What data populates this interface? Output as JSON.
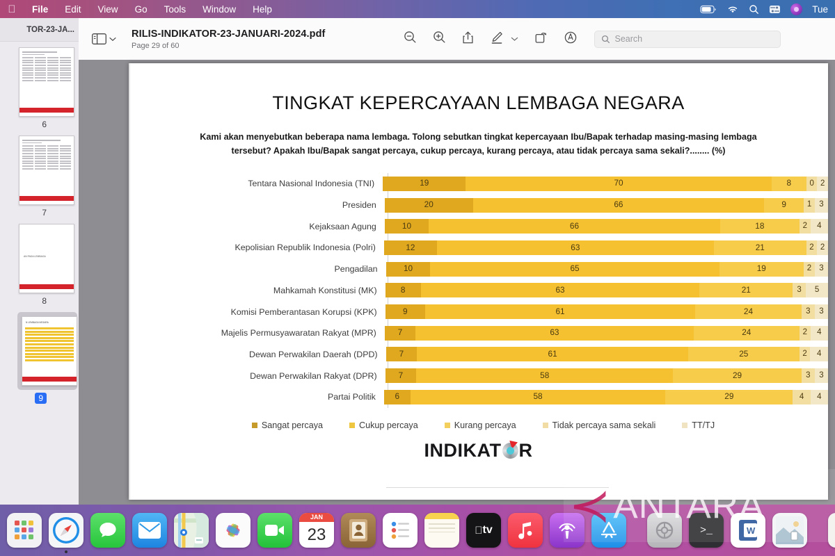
{
  "menubar": {
    "apple_icon": "apple-logo-icon",
    "items": [
      "File",
      "Edit",
      "View",
      "Go",
      "Tools",
      "Window",
      "Help"
    ],
    "status_icons": [
      "battery-icon",
      "wifi-icon",
      "search-icon",
      "control-center-icon",
      "siri-icon"
    ],
    "clock": "Tue"
  },
  "toolbar": {
    "sidebar_toggle_icon": "sidebar-toggle-icon",
    "chevron_icon": "chevron-down-icon",
    "document_title": "RILIS-INDIKATOR-23-JANUARI-2024.pdf",
    "page_status": "Page 29 of 60",
    "icons": [
      "zoom-out-icon",
      "zoom-in-icon",
      "share-icon",
      "markup-icon",
      "markup-chevron-icon",
      "rotate-icon",
      "annotate-icon"
    ],
    "search_placeholder": "Search"
  },
  "sidebar": {
    "header_title": "TOR-23-JA...",
    "thumbnails": [
      {
        "page": "6",
        "kind": "table",
        "selected": false
      },
      {
        "page": "7",
        "kind": "table",
        "selected": false
      },
      {
        "page": "8",
        "kind": "section",
        "caption": "AN PADA LEMBAGA",
        "selected": false
      },
      {
        "page": "9",
        "kind": "chart",
        "caption": "N LEMBAGA NEGARA",
        "selected": true
      }
    ]
  },
  "chart_data": {
    "type": "bar",
    "orientation": "horizontal",
    "stacked": true,
    "title": "TINGKAT KEPERCAYAAN LEMBAGA NEGARA",
    "subtitle": "Kami akan menyebutkan beberapa nama lembaga. Tolong sebutkan tingkat kepercayaan Ibu/Bapak terhadap masing-masing lembaga tersebut? Apakah Ibu/Bapak sangat percaya, cukup percaya, kurang percaya, atau tidak percaya sama sekali?........ (%)",
    "xlabel": "",
    "ylabel": "",
    "xlim": [
      0,
      100
    ],
    "grid": false,
    "legend_position": "bottom",
    "legend": [
      "Sangat percaya",
      "Cukup percaya",
      "Kurang percaya",
      "Tidak percaya sama sekali",
      "TT/TJ"
    ],
    "colors": [
      "#e0a81f",
      "#f5c130",
      "#f7cc4b",
      "#f3dea1",
      "#f2e7c7"
    ],
    "categories": [
      "Tentara Nasional Indonesia (TNI)",
      "Presiden",
      "Kejaksaan Agung",
      "Kepolisian Republik Indonesia (Polri)",
      "Pengadilan",
      "Mahkamah Konstitusi (MK)",
      "Komisi Pemberantasan Korupsi (KPK)",
      "Majelis Permusyawaratan Rakyat (MPR)",
      "Dewan Perwakilan Daerah (DPD)",
      "Dewan Perwakilan Rakyat (DPR)",
      "Partai Politik"
    ],
    "series": [
      {
        "name": "Sangat percaya",
        "values": [
          19,
          20,
          10,
          12,
          10,
          8,
          9,
          7,
          7,
          7,
          6
        ]
      },
      {
        "name": "Cukup percaya",
        "values": [
          70,
          66,
          66,
          63,
          65,
          63,
          61,
          63,
          61,
          58,
          58
        ]
      },
      {
        "name": "Kurang percaya",
        "values": [
          8,
          9,
          18,
          21,
          19,
          21,
          24,
          24,
          25,
          29,
          29
        ]
      },
      {
        "name": "Tidak percaya sama sekali",
        "values": [
          0,
          1,
          2,
          2,
          2,
          3,
          3,
          2,
          2,
          3,
          4
        ]
      },
      {
        "name": "TT/TJ",
        "values": [
          2,
          3,
          4,
          2,
          3,
          5,
          3,
          4,
          4,
          3,
          4
        ]
      }
    ],
    "brand": "INDIKAT",
    "brand_tail": "R"
  },
  "dock": {
    "items": [
      "launchpad-icon",
      "safari-icon",
      "messages-icon",
      "mail-icon",
      "maps-icon",
      "photos-icon",
      "facetime-icon",
      "calendar-icon",
      "contacts-icon",
      "reminders-icon",
      "notes-icon",
      "appletv-icon",
      "music-icon",
      "podcasts-icon",
      "appstore-icon",
      "system-settings-icon",
      "terminal-icon",
      "word-icon",
      "preview-icon",
      "printer-folder-icon",
      "documents-stack-icon"
    ],
    "calendar_month": "JAN",
    "calendar_day": "23"
  },
  "watermark": {
    "text": "ANTARA",
    "mark": "angle-mark-icon"
  }
}
